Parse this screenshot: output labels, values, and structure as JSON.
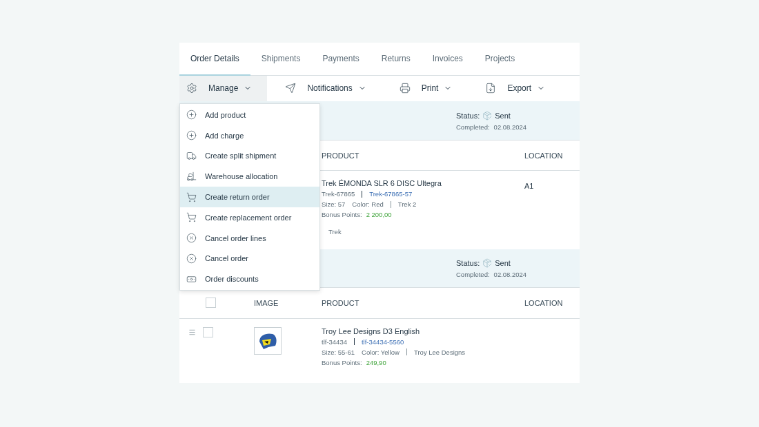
{
  "tabs": [
    {
      "label": "Order Details",
      "selected": true
    },
    {
      "label": "Shipments",
      "selected": false
    },
    {
      "label": "Payments",
      "selected": false
    },
    {
      "label": "Returns",
      "selected": false
    },
    {
      "label": "Invoices",
      "selected": false
    },
    {
      "label": "Projects",
      "selected": false
    }
  ],
  "toolbar": [
    {
      "kind": "manage",
      "label": "Manage",
      "active": true
    },
    {
      "kind": "notifications",
      "label": "Notifications",
      "active": false
    },
    {
      "kind": "print",
      "label": "Print",
      "active": false
    },
    {
      "kind": "export",
      "label": "Export",
      "active": false
    }
  ],
  "menu": [
    {
      "kind": "add",
      "label": "Add product",
      "selected": false
    },
    {
      "kind": "add",
      "label": "Add charge",
      "selected": false
    },
    {
      "kind": "split",
      "label": "Create split shipment",
      "selected": false
    },
    {
      "kind": "warehouse",
      "label": "Warehouse allocation",
      "selected": false
    },
    {
      "kind": "return",
      "label": "Create return order",
      "selected": true
    },
    {
      "kind": "return",
      "label": "Create replacement order",
      "selected": false
    },
    {
      "kind": "cancel",
      "label": "Cancel order lines",
      "selected": false
    },
    {
      "kind": "cancel",
      "label": "Cancel order",
      "selected": false
    },
    {
      "kind": "discount",
      "label": "Order discounts",
      "selected": false
    }
  ],
  "sections": [
    {
      "status_label": "Status:",
      "status": "Sent",
      "completed_label": "Completed:",
      "completed": "02.08.2024",
      "columns": [
        {
          "kind": "product",
          "label": "PRODUCT"
        },
        {
          "kind": "location",
          "label": "LOCATION"
        }
      ],
      "row": {
        "name": "Trek ÉMONDA SLR 6 DISC Ultegra",
        "sku": "Trek-67865",
        "variant_sku": "Trek-67865-57",
        "size": "Size: 57",
        "color_text": "Color: Red",
        "brand": "Trek 2",
        "bonus_label": "Bonus Points:",
        "bonus": "2 200,00",
        "location": "A1",
        "note": "Trek"
      }
    },
    {
      "status_label": "Status:",
      "status": "Sent",
      "completed_label": "Completed:",
      "completed": "02.08.2024",
      "header_checkbox": {
        "checked": false
      },
      "columns": [
        {
          "kind": "image",
          "label": "IMAGE"
        },
        {
          "kind": "product",
          "label": "PRODUCT"
        },
        {
          "kind": "location",
          "label": "LOCATION"
        }
      ],
      "row": {
        "checked": false,
        "name": "Troy Lee Designs D3 English",
        "sku": "tlf-34434",
        "variant_sku": "tlf-34434-5560",
        "size": "Size: 55-61",
        "color_text": "Color: Yellow",
        "brand": "Troy Lee Designs",
        "bonus_label": "Bonus Points:",
        "bonus": "249,90"
      }
    }
  ]
}
